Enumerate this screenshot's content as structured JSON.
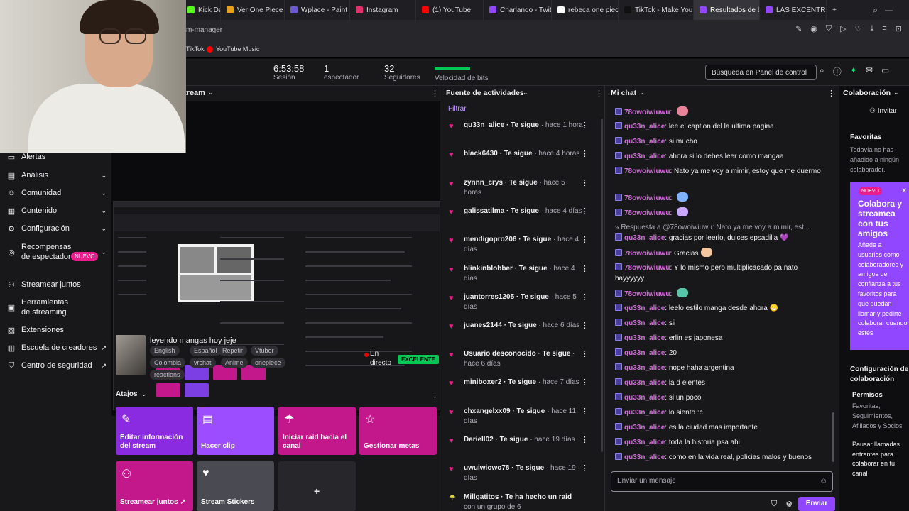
{
  "browser": {
    "tabs": [
      {
        "label": "Kick Dashb",
        "color": "#53fc18"
      },
      {
        "label": "Ver One Piece Cap",
        "color": "#e8a317"
      },
      {
        "label": "Wplace - Paint the",
        "color": "#6a5acd"
      },
      {
        "label": "Instagram",
        "color": "#e1306c"
      },
      {
        "label": "(1) YouTube",
        "color": "#ff0000"
      },
      {
        "label": "Charlando - Twitch",
        "color": "#9147ff"
      },
      {
        "label": "rebeca one piece -",
        "color": "#ffffff"
      },
      {
        "label": "TikTok - Make Your",
        "color": "#111111"
      },
      {
        "label": "Resultados de búsq",
        "color": "#9147ff"
      },
      {
        "label": "LAS EXCENTRICAS",
        "color": "#9147ff"
      }
    ],
    "new_tab": "+",
    "address_fragment": "m-manager",
    "bookmarks": [
      "TikTok",
      "YouTube Music"
    ]
  },
  "stats": {
    "session_time": "6:53:58",
    "session_label": "Sesión",
    "viewers": "1",
    "viewers_label": "espectador",
    "followers": "32",
    "followers_label": "Seguidores",
    "bitrate_label": "Velocidad de bits",
    "search_placeholder": "Búsqueda en Panel de control"
  },
  "nav": [
    {
      "label": "Alertas",
      "icon": "alert-icon",
      "glyph": "▭",
      "chevron": false
    },
    {
      "label": "Análisis",
      "icon": "analytics-icon",
      "glyph": "▤",
      "chevron": true
    },
    {
      "label": "Comunidad",
      "icon": "community-icon",
      "glyph": "☺",
      "chevron": true
    },
    {
      "label": "Contenido",
      "icon": "content-icon",
      "glyph": "▦",
      "chevron": true
    },
    {
      "label": "Configuración",
      "icon": "gear-icon",
      "glyph": "⚙",
      "chevron": true
    },
    {
      "label": "Recompensas de espectador",
      "icon": "rewards-icon",
      "glyph": "◎",
      "chevron": true
    },
    {
      "label": "Streamear juntos",
      "icon": "stream-together-icon",
      "glyph": "⚇",
      "chevron": false
    },
    {
      "label": "Herramientas de streaming",
      "icon": "tools-icon",
      "glyph": "▣",
      "chevron": false
    },
    {
      "label": "Extensiones",
      "icon": "extensions-icon",
      "glyph": "▨",
      "chevron": false
    },
    {
      "label": "Escuela de creadores",
      "icon": "school-icon",
      "glyph": "▥",
      "chevron": false,
      "external": true
    },
    {
      "label": "Centro de seguridad",
      "icon": "shield-icon",
      "glyph": "⛉",
      "chevron": false,
      "external": true
    }
  ],
  "nav_new_badge": "NUEVO",
  "stream": {
    "header": "tream",
    "title": "leyendo mangas hoy jeje",
    "tags": [
      "English",
      "Español",
      "Repetir",
      "Vtuber",
      "Colombia",
      "vrchat",
      "Anime",
      "onepiece",
      "reactions"
    ],
    "live_label": "En directo",
    "quality": "EXCELENTE",
    "shortcuts_header": "Atajos",
    "shortcuts": [
      {
        "label": "Editar información del stream",
        "icon": "pencil-icon",
        "glyph": "✎",
        "color": "#8a2be2"
      },
      {
        "label": "Hacer clip",
        "icon": "clip-icon",
        "glyph": "▤",
        "color": "#9b4dff"
      },
      {
        "label": "Iniciar raid hacia el canal",
        "icon": "raid-icon",
        "glyph": "☂",
        "color": "#c2188b"
      },
      {
        "label": "Gestionar metas",
        "icon": "star-icon",
        "glyph": "☆",
        "color": "#c2188b"
      },
      {
        "label": "Streamear juntos ↗",
        "icon": "add-user-icon",
        "glyph": "⚇",
        "color": "#c2188b"
      },
      {
        "label": "Stream Stickers",
        "icon": "heart-sticker-icon",
        "glyph": "♥",
        "color": "#4a4a52"
      },
      {
        "label": "+",
        "icon": "plus-icon",
        "glyph": "",
        "color": "#26262b"
      }
    ]
  },
  "activity": {
    "header": "Fuente de actividades",
    "filter": "Filtrar",
    "items": [
      {
        "user": "qu33n_alice",
        "action": " · Te sigue",
        "time": " · hace 1 hora"
      },
      {
        "user": "black6430",
        "action": " · Te sigue",
        "time": " · hace 4 horas"
      },
      {
        "user": "zynnn_crys",
        "action": " · Te sigue",
        "time": " · hace 5 horas"
      },
      {
        "user": "galissatilma",
        "action": " · Te sigue",
        "time": " · hace 4 días"
      },
      {
        "user": "mendigopro206",
        "action": " · Te sigue",
        "time": " · hace 4 días"
      },
      {
        "user": "blinkinblobber",
        "action": " · Te sigue",
        "time": " · hace 4 días"
      },
      {
        "user": "juantorres1205",
        "action": " · Te sigue",
        "time": " · hace 5 días"
      },
      {
        "user": "juanes2144",
        "action": " · Te sigue",
        "time": " · hace 6 días"
      },
      {
        "user": "Usuario desconocido",
        "action": " · Te sigue",
        "time": " · hace 6 días"
      },
      {
        "user": "miniboxer2",
        "action": " · Te sigue",
        "time": " · hace 7 días"
      },
      {
        "user": "chxangelxx09",
        "action": " · Te sigue",
        "time": " · hace 11 días"
      },
      {
        "user": "Dariell02",
        "action": " · Te sigue",
        "time": " · hace 19 días"
      },
      {
        "user": "uwuiwiowo78",
        "action": " · Te sigue",
        "time": " · hace 19 días"
      },
      {
        "user": "Millgatitos",
        "action": " · Te ha hecho un raid",
        "time": " con un grupo de 6"
      }
    ]
  },
  "chat": {
    "header": "Mi chat",
    "messages": [
      {
        "user": "78owoiwiuwu",
        "text": "",
        "emote": "#e8839a"
      },
      {
        "user": "qu33n_alice",
        "text": "lee el caption del la ultima pagina"
      },
      {
        "user": "qu33n_alice",
        "text": "si mucho"
      },
      {
        "user": "qu33n_alice",
        "text": "ahora si lo debes leer como mangaa"
      },
      {
        "user": "78owoiwiuwu",
        "text": "Nato ya me voy a mimir, estoy que me duermo"
      },
      {
        "user": "78owoiwiuwu",
        "text": "",
        "emote": "#7fb3ff"
      },
      {
        "user": "78owoiwiuwu",
        "text": "",
        "emote": "#c9a7ff"
      },
      {
        "reply": "Respuesta a @78owoiwiuwu: Nato ya me voy a mimir, est..."
      },
      {
        "user": "qu33n_alice",
        "text": "gracias por leerlo, dulces epsadilla 💜"
      },
      {
        "user": "78owoiwiuwu",
        "text": "Gracias",
        "emote": "#f3c6a0"
      },
      {
        "user": "78owoiwiuwu",
        "text": "Y lo mismo pero multiplicacado pa nato bayyyyyy"
      },
      {
        "user": "78owoiwiuwu",
        "text": "",
        "emote": "#58c4a8"
      },
      {
        "user": "qu33n_alice",
        "text": "leelo estilo manga desde ahora 😁"
      },
      {
        "user": "qu33n_alice",
        "text": "sii"
      },
      {
        "user": "qu33n_alice",
        "text": "erlin es japonesa"
      },
      {
        "user": "qu33n_alice",
        "text": "20"
      },
      {
        "user": "qu33n_alice",
        "text": "nope haha argentina"
      },
      {
        "user": "qu33n_alice",
        "text": "la d elentes"
      },
      {
        "user": "qu33n_alice",
        "text": "si un poco"
      },
      {
        "user": "qu33n_alice",
        "text": "lo siento :c"
      },
      {
        "user": "qu33n_alice",
        "text": "es la ciudad mas importante"
      },
      {
        "user": "qu33n_alice",
        "text": "toda la historia psa ahi"
      },
      {
        "user": "qu33n_alice",
        "text": "como en la vida real, policias malos y buenos"
      }
    ],
    "input_placeholder": "Enviar un mensaje",
    "send_label": "Enviar"
  },
  "collab": {
    "header": "Colaboración",
    "invite": "Invitar",
    "favorites_title": "Favoritas",
    "favorites_empty": "Todavía no has añadido a ningún colaborador.",
    "promo_new": "NUEVO",
    "promo_title": "Colabora y streamea con tus amigos",
    "promo_body": "Añade a usuarios como colaboradores y amigos de confianza a tus favoritos para que puedan llamar y pedirte colaborar cuando estés",
    "config_title": "Configuración de colaboración",
    "permissions_title": "Permisos",
    "permissions_body": "Favoritas, Seguimientos, Afiliados y Socios",
    "pause_body": "Pausar llamadas entrantes para colaborar en tu canal"
  }
}
